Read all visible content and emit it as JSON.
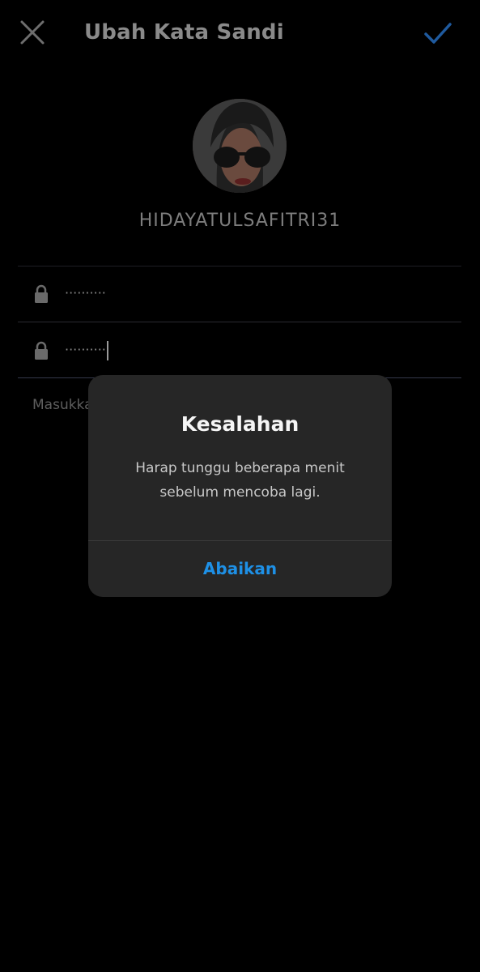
{
  "header": {
    "title": "Ubah Kata Sandi",
    "close_icon": "close-icon",
    "confirm_icon": "check-icon"
  },
  "profile": {
    "username": "HIDAYATULSAFITRI31"
  },
  "fields": [
    {
      "icon": "lock-icon",
      "value": "··········"
    },
    {
      "icon": "lock-icon",
      "value": "··········"
    }
  ],
  "helper": {
    "text": "Masukka"
  },
  "dialog": {
    "title": "Kesalahan",
    "message_line1": "Harap tunggu beberapa menit",
    "message_line2": "sebelum mencoba lagi.",
    "button_label": "Abaikan"
  },
  "colors": {
    "accent": "#1e90e6",
    "confirm_check": "#1f5a9e",
    "dialog_bg": "#262626",
    "background": "#000000"
  }
}
